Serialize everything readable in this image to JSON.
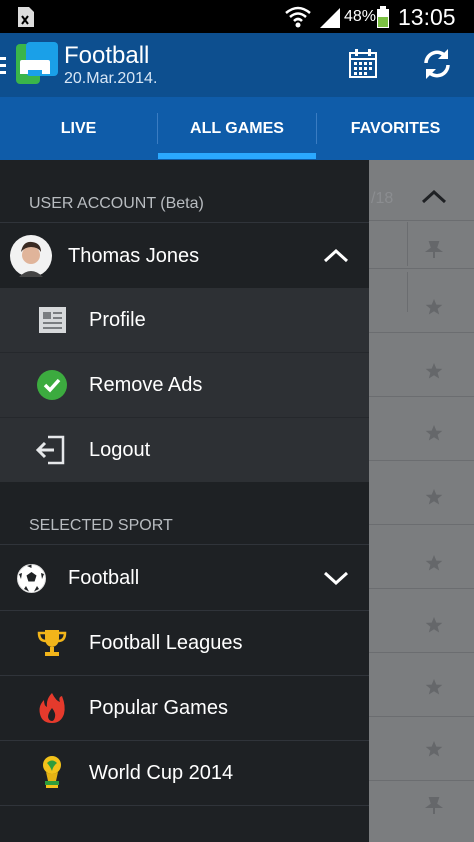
{
  "status_bar": {
    "battery_percent": "48%",
    "time": "13:05",
    "icons": [
      "sim-icon",
      "wifi-icon",
      "signal-icon",
      "battery-icon"
    ]
  },
  "app_bar": {
    "title": "Football",
    "date": "20.Mar.2014.",
    "icons": [
      "menu-icon",
      "app-logo-icon",
      "calendar-icon",
      "refresh-icon"
    ]
  },
  "tabs": [
    {
      "label": "LIVE"
    },
    {
      "label": "ALL GAMES",
      "selected": true
    },
    {
      "label": "FAVORITES"
    }
  ],
  "drawer": {
    "user_section_header": "USER ACCOUNT (Beta)",
    "user_name": "Thomas Jones",
    "user_items": [
      {
        "label": "Profile",
        "icon": "profile-icon"
      },
      {
        "label": "Remove Ads",
        "icon": "check-icon"
      },
      {
        "label": "Logout",
        "icon": "logout-icon"
      }
    ],
    "sport_section_header": "SELECTED SPORT",
    "sport_name": "Football",
    "sport_items": [
      {
        "label": "Football Leagues",
        "icon": "trophy-icon"
      },
      {
        "label": "Popular Games",
        "icon": "fire-icon"
      },
      {
        "label": "World Cup 2014",
        "icon": "world-cup-icon"
      }
    ]
  },
  "background_content": {
    "partial_text": "/18"
  },
  "colors": {
    "app_bar": "#0d4f8f",
    "tabs": "#0f5ca9",
    "tab_indicator": "#2aa8ff",
    "drawer": "#1e2124",
    "drawer_subitem": "#2d3034",
    "check_green": "#3cab3f",
    "trophy_gold": "#f2b51a",
    "fire_red": "#e53a2c"
  }
}
